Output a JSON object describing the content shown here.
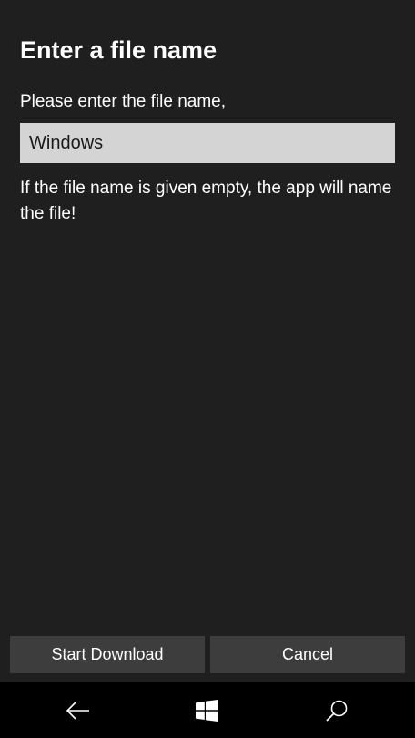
{
  "dialog": {
    "title": "Enter a file name",
    "prompt": "Please enter the file name,",
    "filename_value": "Windows",
    "hint": "If the file name is given empty, the app will name the file!",
    "start_button_label": "Start Download",
    "cancel_button_label": "Cancel"
  },
  "navbar": {
    "icons": [
      "back-arrow-icon",
      "windows-logo-icon",
      "search-icon"
    ]
  },
  "colors": {
    "dialog_background": "#1f1f1f",
    "input_background": "#d4d4d4",
    "button_background": "#3d3d3d",
    "navbar_background": "#000000",
    "text": "#ffffff"
  }
}
